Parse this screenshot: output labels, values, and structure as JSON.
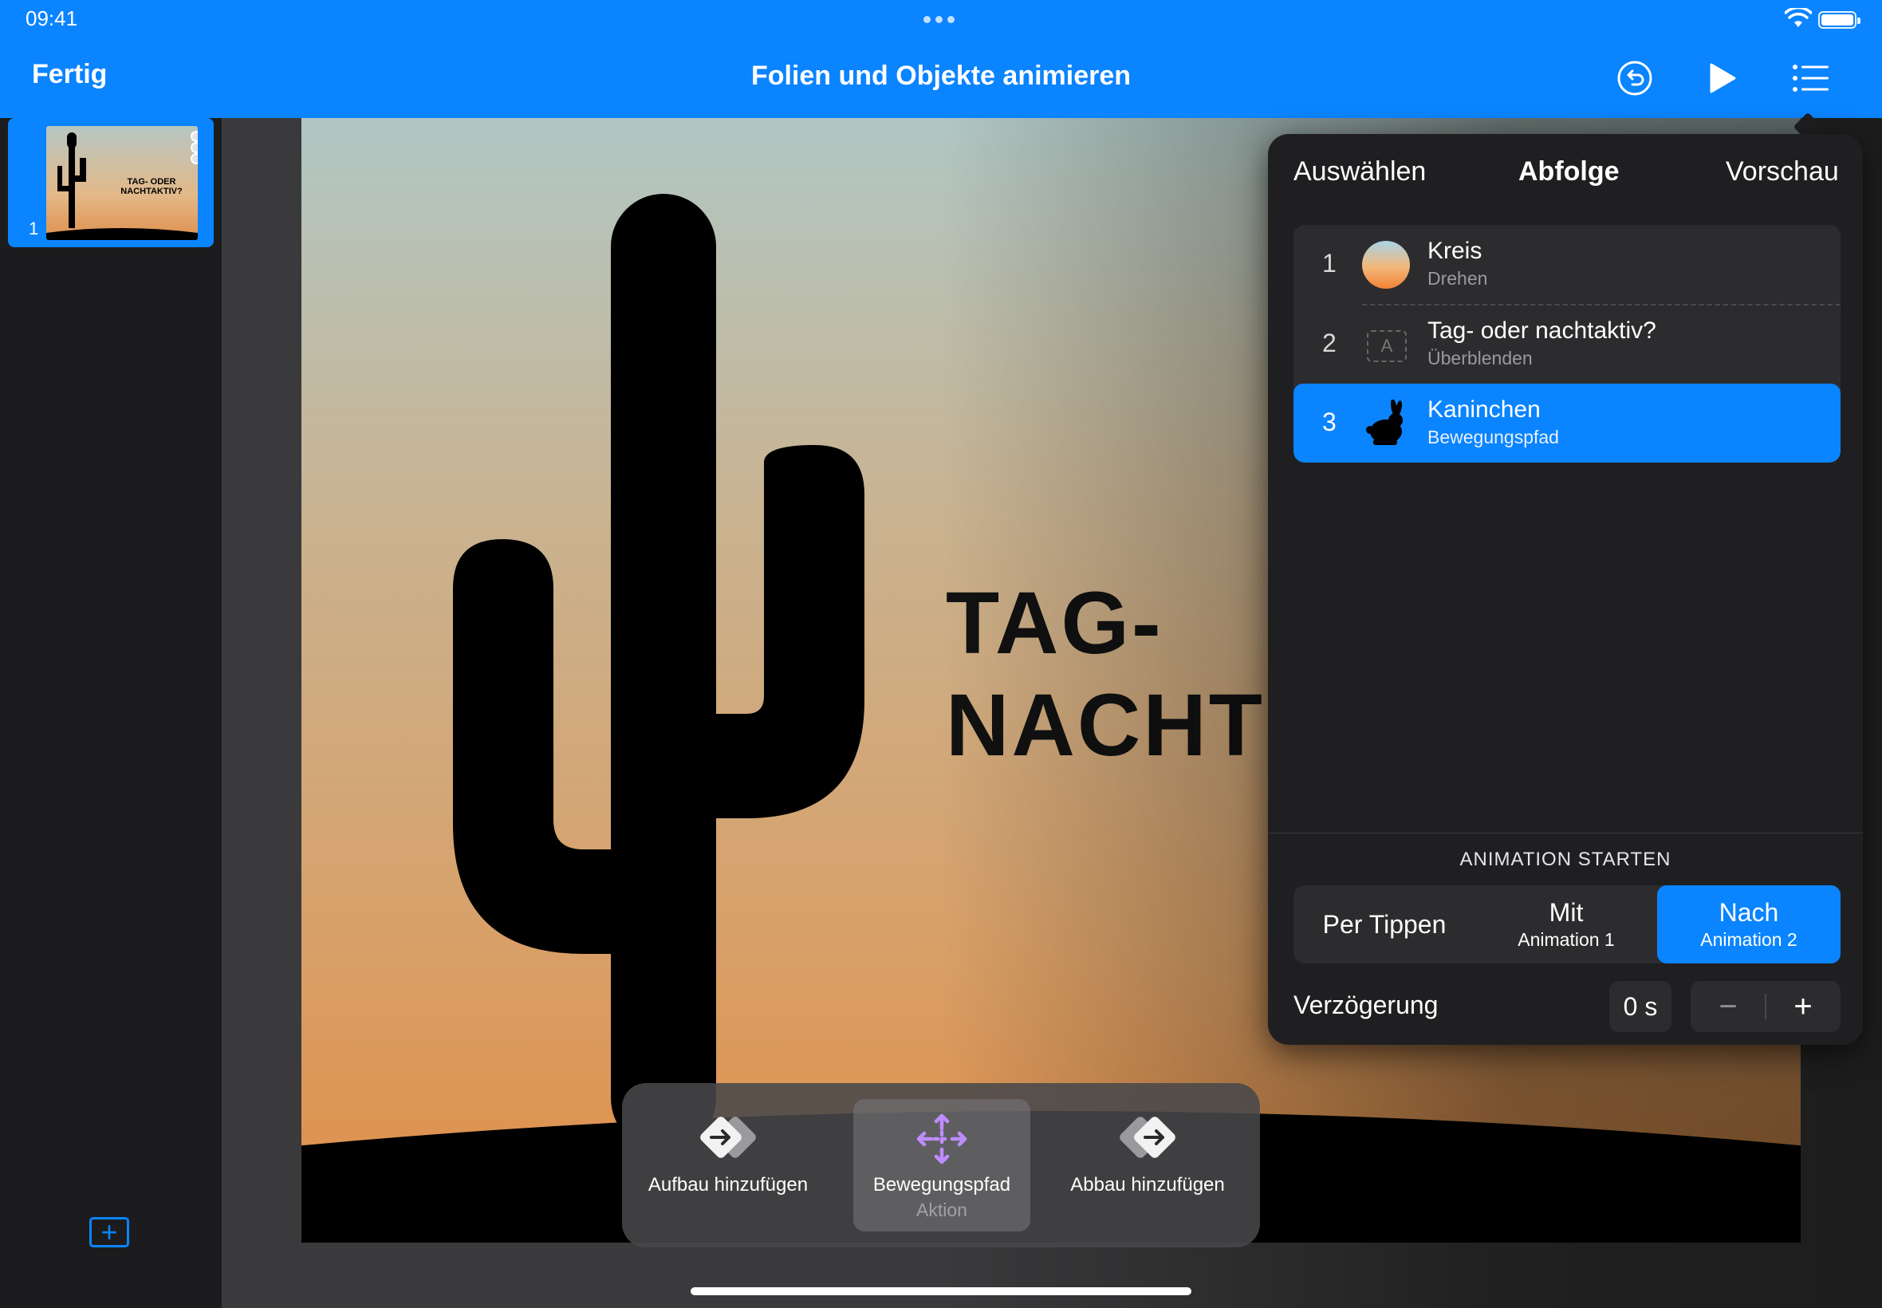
{
  "status_bar": {
    "time": "09:41"
  },
  "header": {
    "done_label": "Fertig",
    "title": "Folien und Objekte animieren"
  },
  "sidebar": {
    "slides": [
      {
        "number": "1",
        "thumb_title": "TAG- ODER NACHTAKTIV?"
      }
    ]
  },
  "slide": {
    "title_line1": "TAG-",
    "title_line2": "NACHT"
  },
  "panel": {
    "tabs": [
      "Auswählen",
      "Abfolge",
      "Vorschau"
    ],
    "active_tab": "Abfolge",
    "animations": [
      {
        "number": "1",
        "name": "Kreis",
        "effect": "Drehen",
        "thumb": "circle-gradient"
      },
      {
        "number": "2",
        "name": "Tag- oder nachtaktiv?",
        "effect": "Überblenden",
        "thumb": "text-box-icon",
        "thumb_letter": "A"
      },
      {
        "number": "3",
        "name": "Kaninchen",
        "effect": "Bewegungspfad",
        "thumb": "rabbit-icon",
        "selected": true
      }
    ],
    "start_heading": "ANIMATION STARTEN",
    "start_options": [
      {
        "main": "Per Tippen",
        "sub": ""
      },
      {
        "main": "Mit",
        "sub": "Animation 1"
      },
      {
        "main": "Nach",
        "sub": "Animation 2",
        "selected": true
      }
    ],
    "delay_label": "Verzögerung",
    "delay_value": "0 s",
    "stepper_minus": "−",
    "stepper_plus": "+"
  },
  "toolbar": {
    "items": [
      {
        "label": "Aufbau hinzufügen",
        "sub": "",
        "icon": "build-in-icon"
      },
      {
        "label": "Bewegungspfad",
        "sub": "Aktion",
        "icon": "move-arrows-icon",
        "active": true
      },
      {
        "label": "Abbau hinzufügen",
        "sub": "",
        "icon": "build-out-icon"
      }
    ]
  },
  "colors": {
    "accent": "#0a84ff",
    "panel_bg": "#1f1f21",
    "action_purple": "#bf8cff"
  }
}
